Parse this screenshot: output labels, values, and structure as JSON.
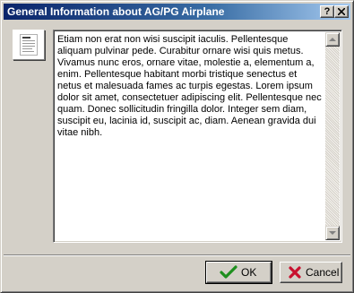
{
  "window": {
    "title": "General Information about AG/PG Airplane",
    "help_label": "?"
  },
  "description": {
    "text": "Etiam non erat non wisi suscipit iaculis. Pellentesque aliquam pulvinar pede. Curabitur ornare wisi quis metus. Vivamus nunc eros, ornare vitae, molestie a, elementum a, enim. Pellentesque habitant morbi tristique senectus et netus et malesuada fames ac turpis egestas. Lorem ipsum dolor sit amet, consectetuer adipiscing elit. Pellentesque nec quam. Donec sollicitudin fringilla dolor. Integer sem diam, suscipit eu, lacinia id, suscipit ac, diam. Aenean gravida dui vitae nibh."
  },
  "buttons": {
    "ok_label": "OK",
    "cancel_label": "Cancel"
  },
  "icons": {
    "document": "document-icon",
    "ok": "checkmark-icon",
    "cancel": "x-icon"
  },
  "colors": {
    "title_start": "#0a246a",
    "title_end": "#a6caf0",
    "face": "#d4d0c8",
    "ok_check": "#1e8f1e",
    "cancel_x": "#c8102e"
  }
}
